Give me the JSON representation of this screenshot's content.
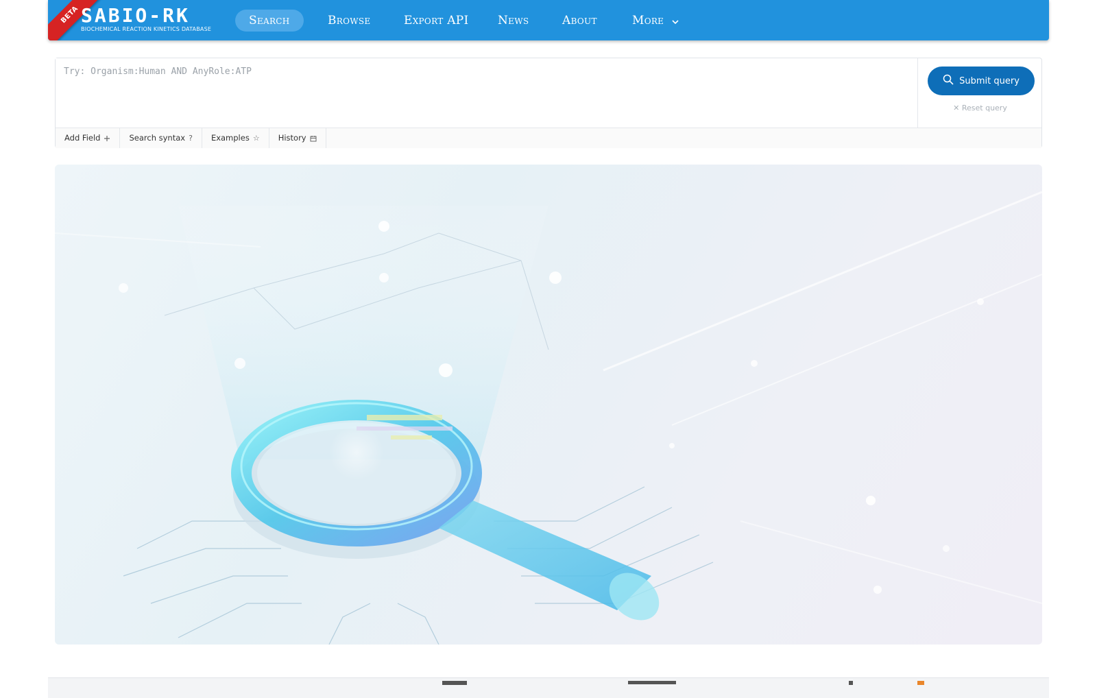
{
  "nav": {
    "ribbon": "BETA",
    "brand_title": "SABIO-RK",
    "brand_subtitle": "Biochemical Reaction Kinetics Database",
    "items": [
      {
        "label": "Search",
        "active": true
      },
      {
        "label": "Browse",
        "active": false
      },
      {
        "label": "Export API",
        "active": false
      },
      {
        "label": "News",
        "active": false
      },
      {
        "label": "About",
        "active": false
      },
      {
        "label": "More",
        "active": false
      }
    ],
    "colors": {
      "bar": "#2192dd",
      "active_pill": "#4ea9e8",
      "ribbon": "#d62323"
    }
  },
  "query": {
    "placeholder": "Try: Organism:Human AND AnyRole:ATP",
    "value": "",
    "submit_label": "Submit query",
    "reset_label": "Reset query",
    "toolbar": [
      {
        "label": "Add Field",
        "icon": "plus-icon"
      },
      {
        "label": "Search syntax",
        "icon": "question-icon"
      },
      {
        "label": "Examples",
        "icon": "star-icon"
      },
      {
        "label": "History",
        "icon": "calendar-icon"
      }
    ],
    "colors": {
      "submit": "#0e6eb8"
    }
  },
  "hero": {
    "image": "magnifying-glass-illustration"
  },
  "footer": {
    "logos": [
      "partner-logo",
      "federal-ministry-logo",
      "partner-logo",
      "partner-logo"
    ]
  }
}
